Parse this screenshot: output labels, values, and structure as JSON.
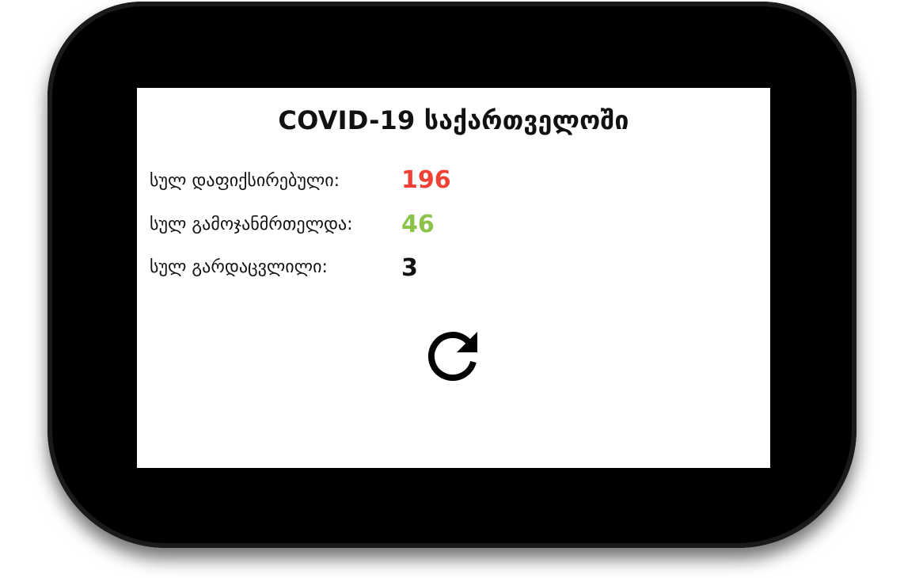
{
  "screen": {
    "title": "COVID-19 საქართველოში"
  },
  "stats": {
    "confirmed": {
      "label": "სულ დაფიქსირებული:",
      "value": "196",
      "color": "#ef4136"
    },
    "recovered": {
      "label": "სულ გამოჯანმრთელდა:",
      "value": "46",
      "color": "#8bc34a"
    },
    "deaths": {
      "label": "სულ გარდაცვლილი:",
      "value": "3",
      "color": "#111111"
    }
  },
  "controls": {
    "refresh_icon": "refresh-icon"
  }
}
